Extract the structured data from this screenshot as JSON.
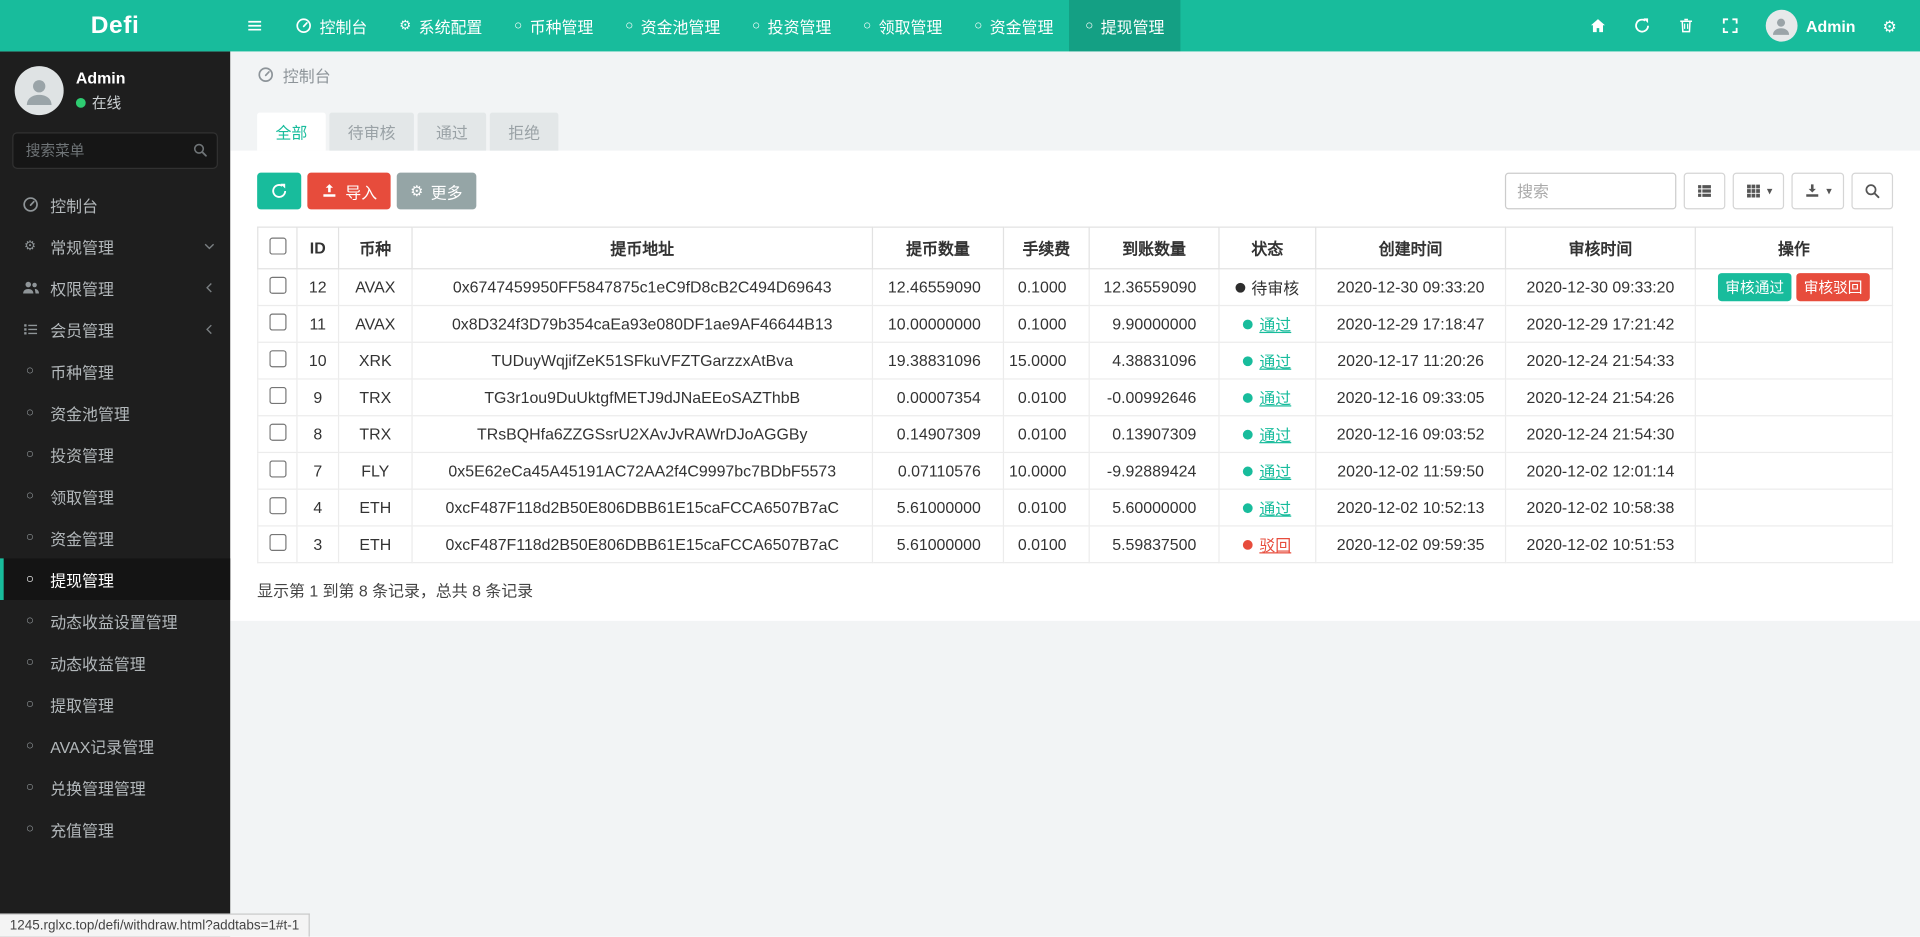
{
  "brand": "Defi",
  "topnav": {
    "items": [
      {
        "label": "控制台",
        "icon": "dashboard",
        "active": false
      },
      {
        "label": "系统配置",
        "icon": "gear",
        "active": false
      },
      {
        "label": "币种管理",
        "icon": "circle",
        "active": false
      },
      {
        "label": "资金池管理",
        "icon": "circle",
        "active": false
      },
      {
        "label": "投资管理",
        "icon": "circle",
        "active": false
      },
      {
        "label": "领取管理",
        "icon": "circle",
        "active": false
      },
      {
        "label": "资金管理",
        "icon": "circle",
        "active": false
      },
      {
        "label": "提现管理",
        "icon": "circle",
        "active": true
      }
    ],
    "right_icons": [
      "home",
      "refresh",
      "trash",
      "fullscreen",
      "user",
      "gears"
    ],
    "user_label": "Admin"
  },
  "sidebar": {
    "user_name": "Admin",
    "user_status": "在线",
    "search_placeholder": "搜索菜单",
    "items": [
      {
        "label": "控制台",
        "icon": "dashboard"
      },
      {
        "label": "常规管理",
        "icon": "gears",
        "chevron": "down"
      },
      {
        "label": "权限管理",
        "icon": "users",
        "chevron": "left"
      },
      {
        "label": "会员管理",
        "icon": "list",
        "chevron": "left"
      },
      {
        "label": "币种管理",
        "icon": "circle"
      },
      {
        "label": "资金池管理",
        "icon": "circle"
      },
      {
        "label": "投资管理",
        "icon": "circle"
      },
      {
        "label": "领取管理",
        "icon": "circle"
      },
      {
        "label": "资金管理",
        "icon": "circle"
      },
      {
        "label": "提现管理",
        "icon": "circle",
        "active": true
      },
      {
        "label": "动态收益设置管理",
        "icon": "circle"
      },
      {
        "label": "动态收益管理",
        "icon": "circle"
      },
      {
        "label": "提取管理",
        "icon": "circle"
      },
      {
        "label": "AVAX记录管理",
        "icon": "circle"
      },
      {
        "label": "兑换管理管理",
        "icon": "circle"
      },
      {
        "label": "充值管理",
        "icon": "circle"
      }
    ]
  },
  "breadcrumb": "控制台",
  "tabs": [
    {
      "label": "全部",
      "active": true
    },
    {
      "label": "待审核",
      "active": false
    },
    {
      "label": "通过",
      "active": false
    },
    {
      "label": "拒绝",
      "active": false
    }
  ],
  "toolbar": {
    "import_label": "导入",
    "more_label": "更多",
    "search_placeholder": "搜索"
  },
  "table": {
    "headers": [
      "ID",
      "币种",
      "提币地址",
      "提币数量",
      "手续费",
      "到账数量",
      "状态",
      "创建时间",
      "审核时间",
      "操作"
    ],
    "rows": [
      {
        "id": "12",
        "coin": "AVAX",
        "address": "0x6747459950FF5847875c1eC9fD8cB2C494D69643",
        "amount": "12.46559090",
        "fee": "0.1000",
        "received": "12.36559090",
        "status": "待审核",
        "status_type": "pending",
        "created": "2020-12-30 09:33:20",
        "reviewed": "2020-12-30 09:33:20",
        "actions": [
          {
            "label": "审核通过",
            "type": "approve"
          },
          {
            "label": "审核驳回",
            "type": "reject"
          }
        ]
      },
      {
        "id": "11",
        "coin": "AVAX",
        "address": "0x8D324f3D79b354caEa93e080DF1ae9AF46644B13",
        "amount": "10.00000000",
        "fee": "0.1000",
        "received": "9.90000000",
        "status": "通过",
        "status_type": "pass",
        "created": "2020-12-29 17:18:47",
        "reviewed": "2020-12-29 17:21:42",
        "actions": []
      },
      {
        "id": "10",
        "coin": "XRK",
        "address": "TUDuyWqjifZeK51SFkuVFZTGarzzxAtBva",
        "amount": "19.38831096",
        "fee": "15.0000",
        "received": "4.38831096",
        "status": "通过",
        "status_type": "pass",
        "created": "2020-12-17 11:20:26",
        "reviewed": "2020-12-24 21:54:33",
        "actions": []
      },
      {
        "id": "9",
        "coin": "TRX",
        "address": "TG3r1ou9DuUktgfMETJ9dJNaEEoSAZThbB",
        "amount": "0.00007354",
        "fee": "0.0100",
        "received": "-0.00992646",
        "status": "通过",
        "status_type": "pass",
        "created": "2020-12-16 09:33:05",
        "reviewed": "2020-12-24 21:54:26",
        "actions": []
      },
      {
        "id": "8",
        "coin": "TRX",
        "address": "TRsBQHfa6ZZGSsrU2XAvJvRAWrDJoAGGBy",
        "amount": "0.14907309",
        "fee": "0.0100",
        "received": "0.13907309",
        "status": "通过",
        "status_type": "pass",
        "created": "2020-12-16 09:03:52",
        "reviewed": "2020-12-24 21:54:30",
        "actions": []
      },
      {
        "id": "7",
        "coin": "FLY",
        "address": "0x5E62eCa45A45191AC72AA2f4C9997bc7BDbF5573",
        "amount": "0.07110576",
        "fee": "10.0000",
        "received": "-9.92889424",
        "status": "通过",
        "status_type": "pass",
        "created": "2020-12-02 11:59:50",
        "reviewed": "2020-12-02 12:01:14",
        "actions": []
      },
      {
        "id": "4",
        "coin": "ETH",
        "address": "0xcF487F118d2B50E806DBB61E15caFCCA6507B7aC",
        "amount": "5.61000000",
        "fee": "0.0100",
        "received": "5.60000000",
        "status": "通过",
        "status_type": "pass",
        "created": "2020-12-02 10:52:13",
        "reviewed": "2020-12-02 10:58:38",
        "actions": []
      },
      {
        "id": "3",
        "coin": "ETH",
        "address": "0xcF487F118d2B50E806DBB61E15caFCCA6507B7aC",
        "amount": "5.61000000",
        "fee": "0.0100",
        "received": "5.59837500",
        "status": "驳回",
        "status_type": "reject",
        "created": "2020-12-02 09:59:35",
        "reviewed": "2020-12-02 10:51:53",
        "actions": []
      }
    ]
  },
  "footer_summary": "显示第 1 到第 8 条记录，总共 8 条记录",
  "status_bar_url": "1245.rglxc.top/defi/withdraw.html?addtabs=1#t-1",
  "colors": {
    "primary": "#18BC9C",
    "danger": "#E74C3C",
    "secondary": "#95A5A6",
    "sidebar_bg": "#1E1E1E",
    "online": "#2ECC71",
    "status_pass": "#18BC9C",
    "status_reject": "#E74C3C",
    "status_pending": "#2D2D2D"
  }
}
